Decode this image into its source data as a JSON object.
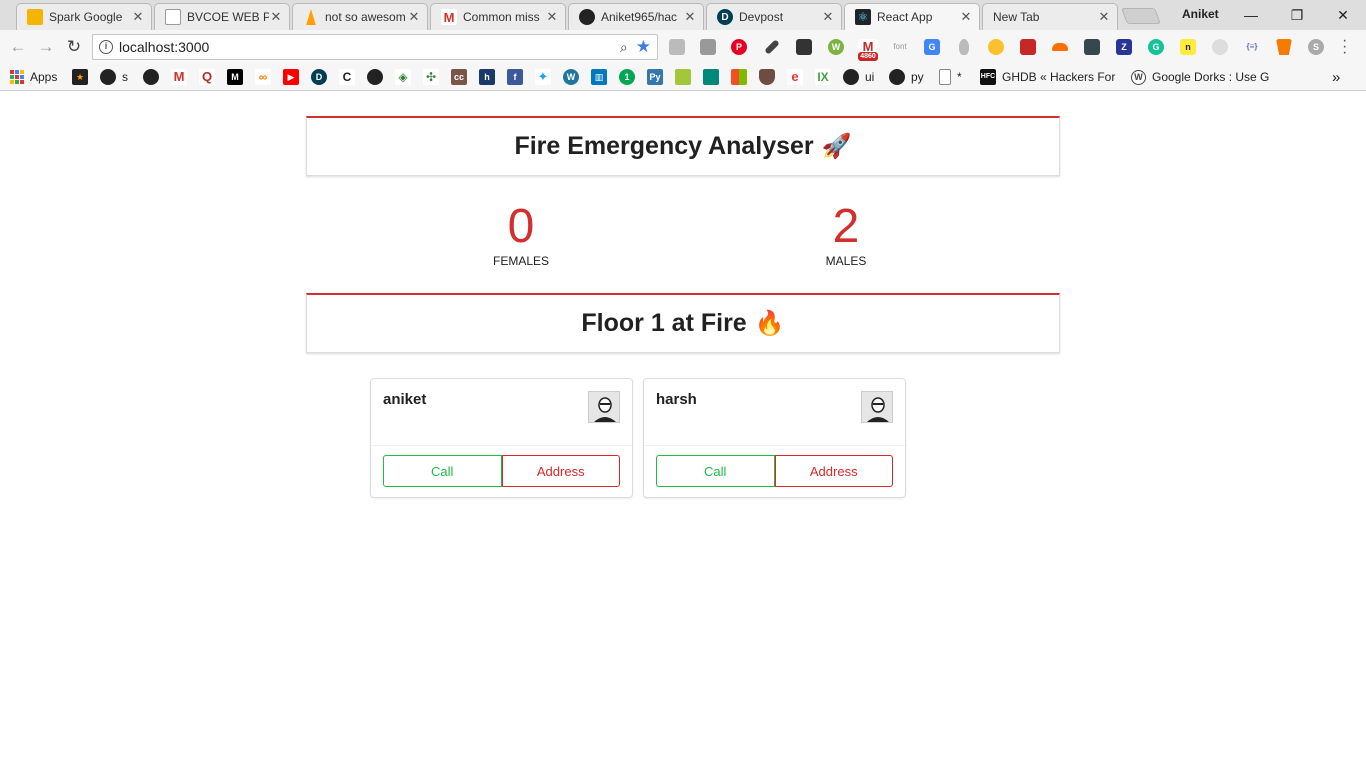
{
  "browser": {
    "tabs": [
      {
        "title": "Spark Google",
        "icon": "google-slides-icon",
        "color": "#f4b400"
      },
      {
        "title": "BVCOE WEB P",
        "icon": "document-icon",
        "color": "#888888"
      },
      {
        "title": "not so awesom",
        "icon": "firebase-icon",
        "color": "#ffa000"
      },
      {
        "title": "Common miss",
        "icon": "gmail-icon",
        "color": "#d93025"
      },
      {
        "title": "Aniket965/hac",
        "icon": "github-icon",
        "color": "#222222"
      },
      {
        "title": "Devpost",
        "icon": "devpost-icon",
        "color": "#003e54"
      },
      {
        "title": "React App",
        "icon": "react-icon",
        "color": "#20232a"
      },
      {
        "title": "New Tab",
        "icon": "",
        "color": "#ececec"
      }
    ],
    "close_glyph": "✕",
    "profile_name": "Aniket",
    "window": {
      "minimize": "—",
      "restore": "❐",
      "close": "✕"
    },
    "url": "localhost:3000",
    "nav": {
      "back": "←",
      "forward": "→",
      "reload": "↻"
    },
    "gmail_badge": "4860",
    "bookmarks": [
      {
        "label": "Apps",
        "icon": "apps-grid-icon"
      },
      {
        "label": "",
        "icon": "star-bookmark-icon",
        "color": "#8a5a00"
      },
      {
        "label": "s",
        "icon": "github-icon",
        "color": "#222"
      },
      {
        "label": "",
        "icon": "github-icon",
        "color": "#222"
      },
      {
        "label": "",
        "icon": "gmail-icon",
        "color": "#d93025"
      },
      {
        "label": "",
        "icon": "quora-icon",
        "color": "#b92b27"
      },
      {
        "label": "",
        "icon": "medium-icon",
        "color": "#000"
      },
      {
        "label": "",
        "icon": "swirl-icon",
        "color": "#ff7a00"
      },
      {
        "label": "",
        "icon": "youtube-icon",
        "color": "#ff0000"
      },
      {
        "label": "",
        "icon": "devpost-icon",
        "color": "#003e54"
      },
      {
        "label": "",
        "icon": "c-icon",
        "color": "#222"
      },
      {
        "label": "",
        "icon": "github-icon",
        "color": "#222"
      },
      {
        "label": "",
        "icon": "diamond-icon",
        "color": "#2f7d32"
      },
      {
        "label": "",
        "icon": "cross-icon",
        "color": "#2e7d32"
      },
      {
        "label": "",
        "icon": "cc-icon",
        "color": "#795548"
      },
      {
        "label": "",
        "icon": "h-icon",
        "color": "#1a3a6b"
      },
      {
        "label": "",
        "icon": "facebook-icon",
        "color": "#3b5998"
      },
      {
        "label": "",
        "icon": "twitter-icon",
        "color": "#1da1f2"
      },
      {
        "label": "",
        "icon": "wordpress-icon",
        "color": "#21759b"
      },
      {
        "label": "",
        "icon": "trello-icon",
        "color": "#0079bf"
      },
      {
        "label": "",
        "icon": "one-icon",
        "color": "#00a651"
      },
      {
        "label": "",
        "icon": "python-icon",
        "color": "#3776ab"
      },
      {
        "label": "",
        "icon": "android-icon",
        "color": "#a4c639"
      },
      {
        "label": "",
        "icon": "box-icon",
        "color": "#00897b"
      },
      {
        "label": "",
        "icon": "windows-icon",
        "color": "#f25022"
      },
      {
        "label": "",
        "icon": "shield-icon",
        "color": "#6d4c41"
      },
      {
        "label": "",
        "icon": "e-icon",
        "color": "#e53935"
      },
      {
        "label": "",
        "icon": "ix-icon",
        "color": "#43a047"
      },
      {
        "label": "ui",
        "icon": "github-icon",
        "color": "#222"
      },
      {
        "label": "py",
        "icon": "github-icon",
        "color": "#222"
      },
      {
        "label": "*",
        "icon": "page-icon",
        "color": "#888"
      },
      {
        "label": "GHDB « Hackers For",
        "icon": "hfc-icon",
        "color": "#111"
      },
      {
        "label": "Google Dorks : Use G",
        "icon": "wordpress-icon",
        "color": "#444"
      }
    ],
    "more_bookmarks": "»"
  },
  "app": {
    "title": "Fire Emergency Analyser",
    "title_emoji": "🚀",
    "stats": [
      {
        "value": "0",
        "label": "FEMALES"
      },
      {
        "value": "2",
        "label": "MALES"
      }
    ],
    "section_title": "Floor 1 at Fire",
    "section_emoji": "🔥",
    "people": [
      {
        "name": "aniket",
        "call_label": "Call",
        "address_label": "Address"
      },
      {
        "name": "harsh",
        "call_label": "Call",
        "address_label": "Address"
      }
    ],
    "colors": {
      "accent": "#d32f2f",
      "call": "#21ba45",
      "address": "#db2828"
    }
  }
}
